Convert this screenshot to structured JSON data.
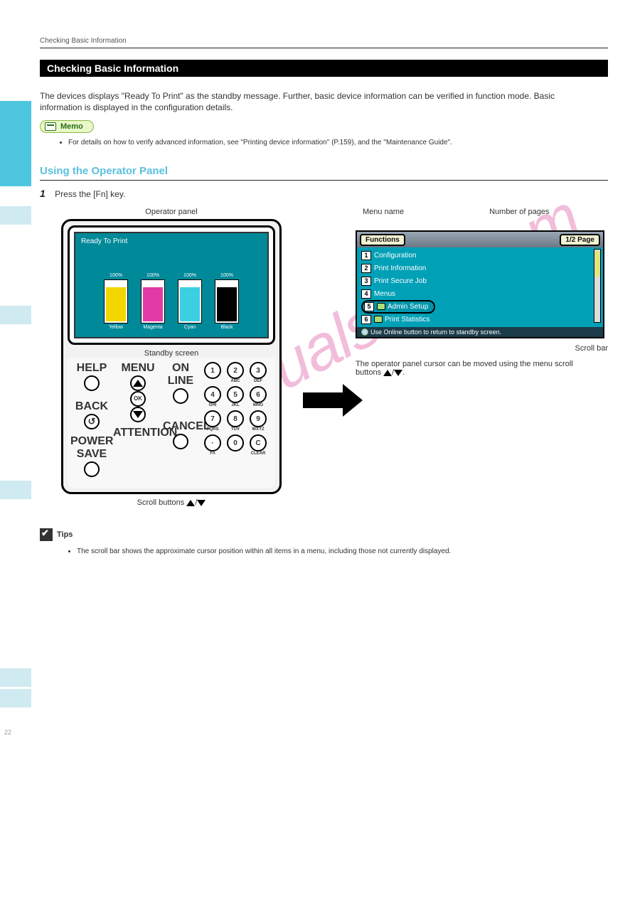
{
  "header": {
    "title": "Checking Basic Information"
  },
  "main_section": "Checking Basic Information",
  "intro": "The devices displays \"Ready To Print\" as the standby message. Further, basic device information can be verified in function mode. Basic information is displayed in the configuration details.",
  "memo": {
    "label": "Memo",
    "items": [
      "For details on how to verify advanced information, see \"Printing device information\" (P.159), and the \"Maintenance Guide\"."
    ]
  },
  "section_a": {
    "title": "Using the Operator Panel",
    "step1_num": "1",
    "step1_text": "Press the [Fn] key.",
    "panel_label": "Operator panel",
    "standby_caption": "Standby screen",
    "screen": {
      "title": "Ready To Print",
      "bars": [
        {
          "pct": "100%",
          "label": "Yellow"
        },
        {
          "pct": "100%",
          "label": "Magenta"
        },
        {
          "pct": "100%",
          "label": "Cyan"
        },
        {
          "pct": "100%",
          "label": "Black"
        }
      ],
      "buttons": {
        "help": "HELP",
        "menu": "MENU",
        "online": "ON LINE",
        "back": "BACK",
        "ok": "OK",
        "cancel": "CANCEL",
        "powersave": "POWER SAVE",
        "attention": "ATTENTION",
        "fn": "Fn",
        "clear": "CLEAR"
      },
      "numpad": {
        "r1": [
          "1",
          "2",
          "3"
        ],
        "r1s": [
          "",
          "ABC",
          "DEF"
        ],
        "r2": [
          "4",
          "5",
          "6"
        ],
        "r2s": [
          "GHI",
          "JKL",
          "MNO"
        ],
        "r3": [
          "7",
          "8",
          "9"
        ],
        "r3s": [
          "PQRS",
          "TUV",
          "WXYZ"
        ],
        "r4": [
          "·",
          "0",
          "C"
        ],
        "r4s": [
          "Fn",
          "",
          "CLEAR"
        ]
      }
    },
    "scroll_caption_full": "Scroll buttons ▲/▼",
    "scroll_prefix": "Scroll buttons "
  },
  "section_fn": {
    "annot": {
      "menu": "Menu name",
      "pages": "Number of pages"
    },
    "titlebar": {
      "left": "Functions",
      "right": "1/2 Page"
    },
    "items": [
      {
        "num": "1",
        "label": "Configuration"
      },
      {
        "num": "2",
        "label": "Print Information"
      },
      {
        "num": "3",
        "label": "Print Secure Job"
      },
      {
        "num": "4",
        "label": "Menus"
      },
      {
        "num": "5",
        "label": "Admin Setup",
        "locked": true,
        "selected": true
      },
      {
        "num": "6",
        "label": "Print Statistics",
        "locked": true
      }
    ],
    "footer": "Use Online button to return to standby screen.",
    "scrollbar_label": "Scroll bar",
    "caption": "The operator panel cursor can be moved using the menu scroll buttons ▲/▼.",
    "caption_prefix": "The operator panel cursor can be moved using the menu scroll buttons "
  },
  "tips": {
    "label": "Tips",
    "items": [
      "The scroll bar shows the approximate cursor position within all items in a menu, including those not currently displayed."
    ]
  },
  "page_number": "22",
  "watermark": "manualslinq.com"
}
